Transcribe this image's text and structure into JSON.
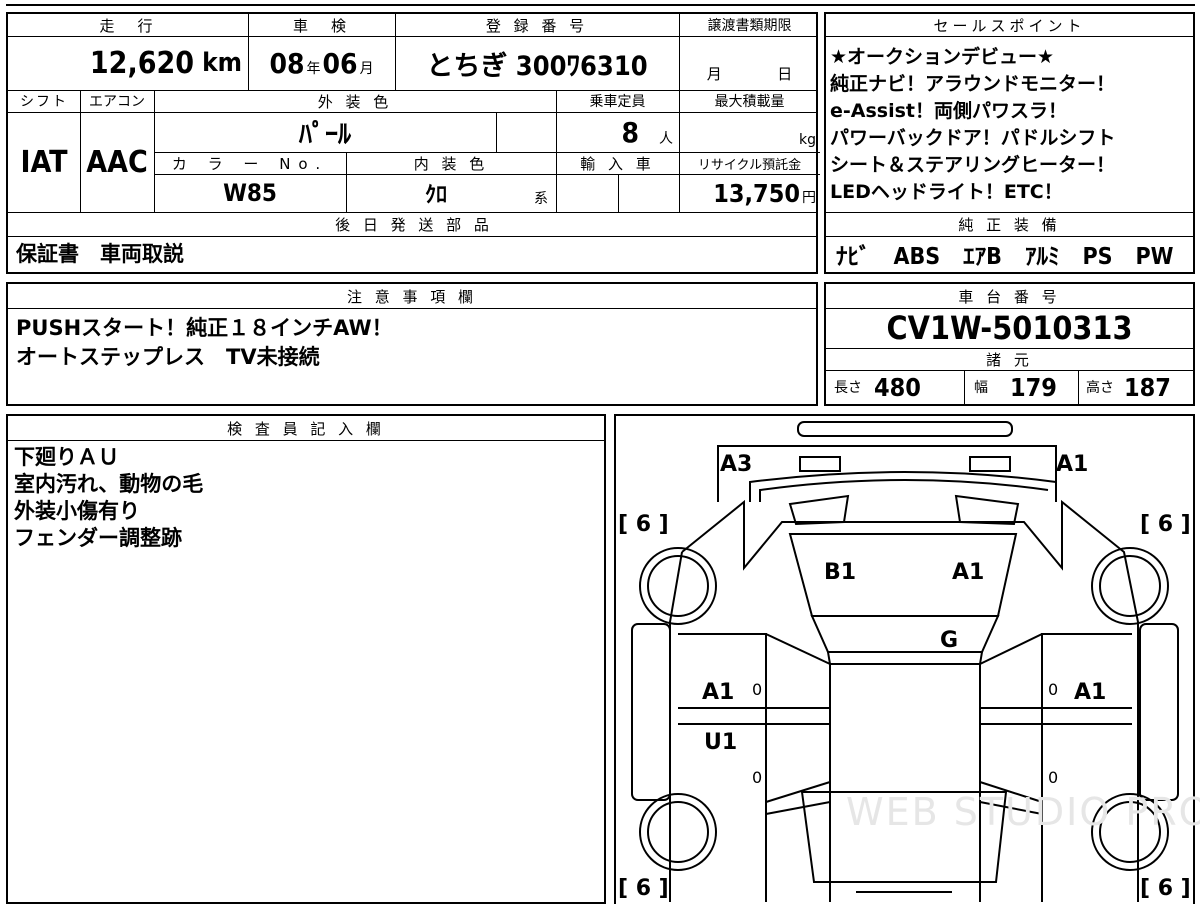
{
  "top_table": {
    "mileage_label": "走　行",
    "mileage_value": "12,620",
    "mileage_unit": "km",
    "inspection_label": "車　検",
    "inspection_year": "08",
    "inspection_year_unit": "年",
    "inspection_month": "06",
    "inspection_month_unit": "月",
    "registration_label": "登 録 番 号",
    "registration_value": "とちぎ 300ﾜ6310",
    "transfer_label": "譲渡書類期限",
    "transfer_month_unit": "月",
    "transfer_day_unit": "日",
    "shift_label": "シフト",
    "shift_value": "IAT",
    "aircon_label": "エアコン",
    "aircon_value": "AAC",
    "exterior_label": "外 装 色",
    "exterior_value": "ﾊﾟｰﾙ",
    "capacity_label": "乗車定員",
    "capacity_value": "8",
    "capacity_unit": "人",
    "maxload_label": "最大積載量",
    "maxload_unit": "kg",
    "color_no_label": "カ ラ ー No.",
    "color_no_value": "W85",
    "interior_label": "内 装 色",
    "interior_value": "ｸﾛ",
    "interior_unit": "系",
    "import_label": "輸 入 車",
    "recycle_label": "リサイクル預託金",
    "recycle_value": "13,750",
    "recycle_unit": "円",
    "later_parts_label": "後 日 発 送 部 品",
    "later_parts_value": "保証書　車両取説"
  },
  "sales_points": {
    "label": "セールスポイント",
    "lines": [
      "★オークションデビュー★",
      "純正ナビ！アラウンドモニター！",
      "e-Assist！両側パワスラ！",
      "パワーバックドア！パドルシフト",
      "シート＆ステアリングヒーター！",
      "LEDヘッドライト！ETC！"
    ]
  },
  "genuine_equipment": {
    "label": "純 正 装 備",
    "value": "ﾅﾋﾞ　ABS　ｴｱB　ｱﾙﾐ　PS　PW"
  },
  "caution": {
    "label": "注 意 事 項 欄",
    "lines": [
      "PUSHスタート！純正１８インチAW！",
      "オートステップレス　TV未接続"
    ]
  },
  "chassis": {
    "label": "車 台 番 号",
    "value": "CV1W-5010313"
  },
  "specs": {
    "label": "諸 元",
    "length_label": "長さ",
    "length_value": "480",
    "width_label": "幅",
    "width_value": "179",
    "height_label": "高さ",
    "height_value": "187"
  },
  "inspector": {
    "label": "検 査 員 記 入 欄",
    "lines": [
      "下廻りＡＵ",
      "室内汚れ、動物の毛",
      "外装小傷有り",
      "フェンダー調整跡"
    ]
  },
  "diagram": {
    "marks": {
      "a3": "A3",
      "a1_front_right": "A1",
      "b1": "B1",
      "a1_hood": "A1",
      "g": "G",
      "a1_left_door": "A1",
      "a1_right_door": "A1",
      "u1": "U1",
      "zero_ld": "0",
      "zero_rd": "0",
      "zero_lr": "0",
      "zero_rr": "0"
    },
    "tire_tl": "[ 6 ]",
    "tire_tr": "[ 6 ]",
    "tire_bl": "[ 6 ]",
    "tire_br": "[ 6 ]",
    "watermark": "WEB STUDIO PRO"
  }
}
